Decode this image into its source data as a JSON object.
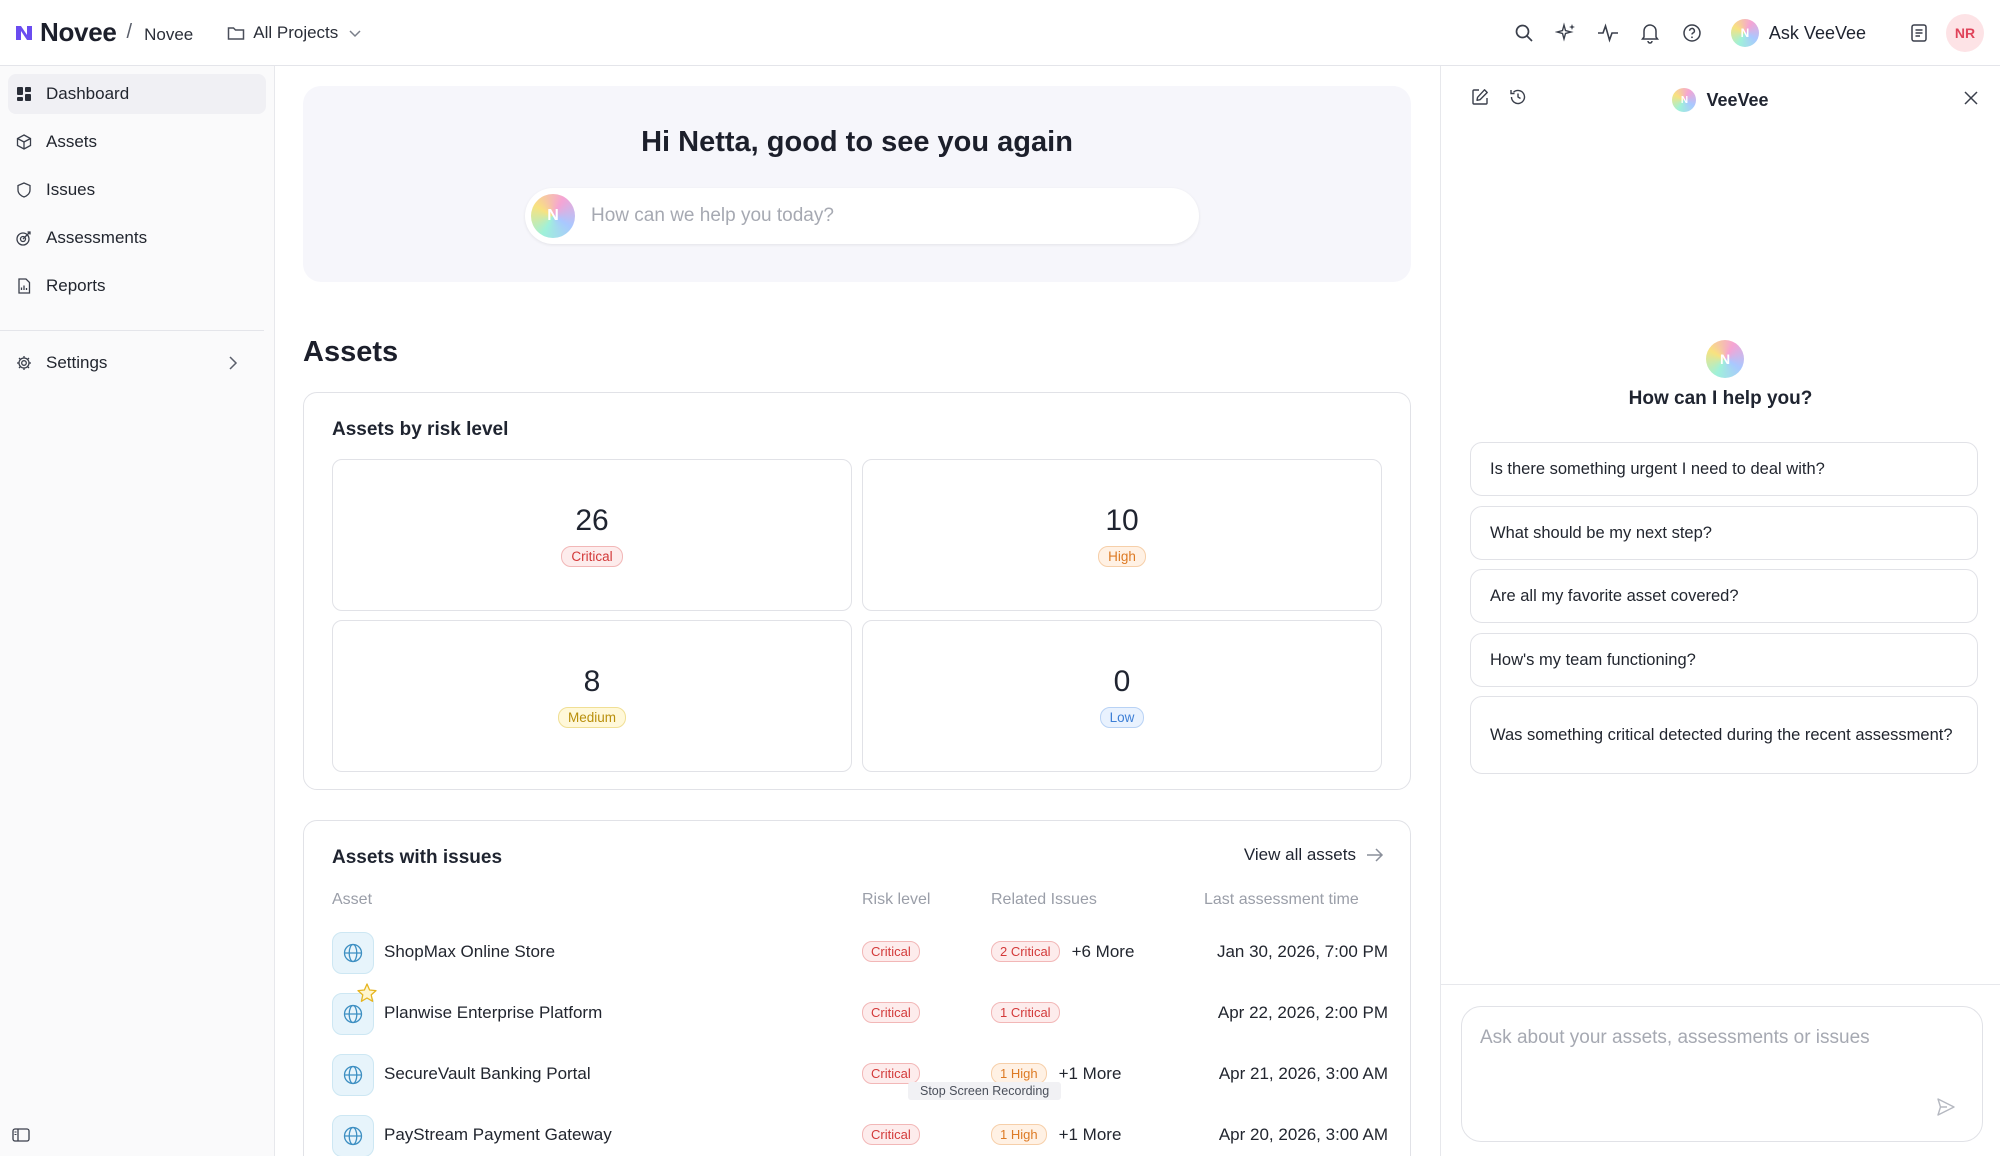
{
  "header": {
    "brand": "Novee",
    "separator": "/",
    "org": "Novee",
    "project": "All Projects",
    "ask_label": "Ask VeeVee",
    "avatar_initials": "NR"
  },
  "sidebar": {
    "items": [
      {
        "label": "Dashboard",
        "icon": "dashboard-icon",
        "active": true
      },
      {
        "label": "Assets",
        "icon": "cube-icon"
      },
      {
        "label": "Issues",
        "icon": "shield-icon"
      },
      {
        "label": "Assessments",
        "icon": "target-icon"
      },
      {
        "label": "Reports",
        "icon": "report-icon"
      }
    ],
    "settings": "Settings"
  },
  "hero": {
    "greeting": "Hi Netta, good to see you again",
    "placeholder": "How can we help you today?"
  },
  "assets_section": {
    "title": "Assets",
    "risk_card_title": "Assets by risk level",
    "risk_levels": [
      {
        "count": "26",
        "label": "Critical"
      },
      {
        "count": "10",
        "label": "High"
      },
      {
        "count": "8",
        "label": "Medium"
      },
      {
        "count": "0",
        "label": "Low"
      }
    ]
  },
  "issues_table": {
    "title": "Assets with issues",
    "view_all": "View all assets",
    "columns": [
      "Asset",
      "Risk level",
      "Related Issues",
      "Last assessment time"
    ],
    "rows": [
      {
        "asset": "ShopMax Online Store",
        "risk": "Critical",
        "issue": "2 Critical",
        "issue_level": "critical",
        "more": "+6 More",
        "time": "Jan 30, 2026, 7:00 PM",
        "favorite": false
      },
      {
        "asset": "Planwise Enterprise Platform",
        "risk": "Critical",
        "issue": "1 Critical",
        "issue_level": "critical",
        "more": "",
        "time": "Apr 22, 2026, 2:00 PM",
        "favorite": true
      },
      {
        "asset": "SecureVault Banking Portal",
        "risk": "Critical",
        "issue": "1 High",
        "issue_level": "high",
        "more": "+1 More",
        "time": "Apr 21, 2026, 3:00 AM",
        "favorite": false
      },
      {
        "asset": "PayStream Payment Gateway",
        "risk": "Critical",
        "issue": "1 High",
        "issue_level": "high",
        "more": "+1 More",
        "time": "Apr 20, 2026, 3:00 AM",
        "favorite": false
      }
    ]
  },
  "tooltip": "Stop Screen Recording",
  "veevee": {
    "title": "VeeVee",
    "help_title": "How can I help you?",
    "suggestions": [
      "Is there something urgent I need to deal with?",
      "What should be my next step?",
      "Are all my favorite asset covered?",
      "How's my team functioning?",
      "Was something critical detected during the recent assessment?"
    ],
    "input_placeholder": "Ask about your assets, assessments or issues"
  },
  "colors": {
    "critical": "#d33a3a",
    "high": "#dd7a24",
    "medium": "#b98f0c",
    "low": "#3d7fd6",
    "brand": "#6a4cf0"
  }
}
